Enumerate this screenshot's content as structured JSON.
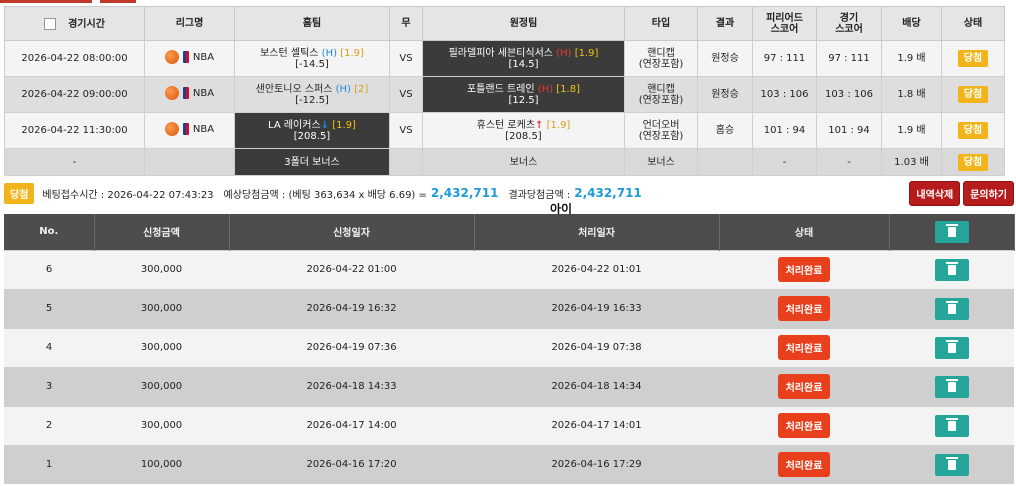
{
  "bet_table": {
    "headers": {
      "time": "경기시간",
      "league": "리그명",
      "home": "홈팀",
      "draw": "무",
      "away": "원정팀",
      "type": "타입",
      "result": "결과",
      "period_score_l1": "피리어드",
      "period_score_l2": "스코어",
      "game_score_l1": "경기",
      "game_score_l2": "스코어",
      "odds": "배당",
      "status": "상태"
    },
    "rows": [
      {
        "time": "2026-04-22 08:00:00",
        "league": "NBA",
        "home": "보스턴 셀틱스",
        "home_h": "(H)",
        "home_odd": "[1.9]",
        "home_line": "[-14.5]",
        "draw": "VS",
        "away": "필라델피아 세븐티식서스",
        "away_h": "(H)",
        "away_odd": "[1.9]",
        "away_line": "[14.5]",
        "type_l1": "핸디캡",
        "type_l2": "(연장포함)",
        "result": "원정승",
        "period_score": "97 : 111",
        "game_score": "97 : 111",
        "odds": "1.9 배",
        "status": "당첨"
      },
      {
        "time": "2026-04-22 09:00:00",
        "league": "NBA",
        "home": "샌안토니오 스퍼스",
        "home_h": "(H)",
        "home_odd": "[2]",
        "home_line": "[-12.5]",
        "draw": "VS",
        "away": "포틀랜드 트레인",
        "away_h": "(H)",
        "away_odd": "[1.8]",
        "away_line": "[12.5]",
        "type_l1": "핸디캡",
        "type_l2": "(연장포함)",
        "result": "원정승",
        "period_score": "103 : 106",
        "game_score": "103 : 106",
        "odds": "1.8 배",
        "status": "당첨"
      },
      {
        "time": "2026-04-22 11:30:00",
        "league": "NBA",
        "home": "LA 레이커스",
        "home_arrow": "↓",
        "home_odd": "[1.9]",
        "home_line": "[208.5]",
        "draw": "VS",
        "away": "휴스턴 로케츠",
        "away_arrow": "↑",
        "away_odd": "[1.9]",
        "away_line": "[208.5]",
        "type_l1": "언더오버",
        "type_l2": "(연장포함)",
        "result": "홈승",
        "period_score": "101 : 94",
        "game_score": "101 : 94",
        "odds": "1.9 배",
        "status": "당첨"
      }
    ],
    "bonus_row": {
      "time": "-",
      "home": "3폴더 보너스",
      "away": "보너스",
      "type": "보너스",
      "period_score": "-",
      "game_score": "-",
      "odds": "1.03 배",
      "status": "당첨"
    }
  },
  "summary": {
    "badge": "당첨",
    "bet_time_label": "베팅접수시간 : 2026-04-22 07:43:23",
    "expected_label": "예상당첨금액 : (베팅 363,634 x 배당 6.69) =",
    "expected_amount": "2,432,711",
    "result_label": "결과당첨금액 :",
    "result_amount": "2,432,711",
    "delete_label": "내역삭제",
    "inquiry_label": "문의하기"
  },
  "background_text": "아이디",
  "history_table": {
    "headers": {
      "no": "No.",
      "amount": "신청금액",
      "requested": "신청일자",
      "processed": "처리일자",
      "status": "상태"
    },
    "rows": [
      {
        "no": "6",
        "amount": "300,000",
        "requested": "2026-04-22 01:00",
        "processed": "2026-04-22 01:01",
        "status": "처리완료"
      },
      {
        "no": "5",
        "amount": "300,000",
        "requested": "2026-04-19 16:32",
        "processed": "2026-04-19 16:33",
        "status": "처리완료"
      },
      {
        "no": "4",
        "amount": "300,000",
        "requested": "2026-04-19 07:36",
        "processed": "2026-04-19 07:38",
        "status": "처리완료"
      },
      {
        "no": "3",
        "amount": "300,000",
        "requested": "2026-04-18 14:33",
        "processed": "2026-04-18 14:34",
        "status": "처리완료"
      },
      {
        "no": "2",
        "amount": "300,000",
        "requested": "2026-04-17 14:00",
        "processed": "2026-04-17 14:01",
        "status": "처리완료"
      },
      {
        "no": "1",
        "amount": "100,000",
        "requested": "2026-04-16 17:20",
        "processed": "2026-04-16 17:29",
        "status": "처리완료"
      }
    ]
  },
  "icons": {
    "trash": "trash-icon",
    "ball": "basketball-icon",
    "league_logo": "nba-logo-icon"
  },
  "colors": {
    "win_badge": "#f2b31b",
    "status_done": "#e8401c",
    "trash_button": "#26a69a",
    "amount_blue": "#1e9bd7",
    "header_dark": "#4d4d4d"
  }
}
